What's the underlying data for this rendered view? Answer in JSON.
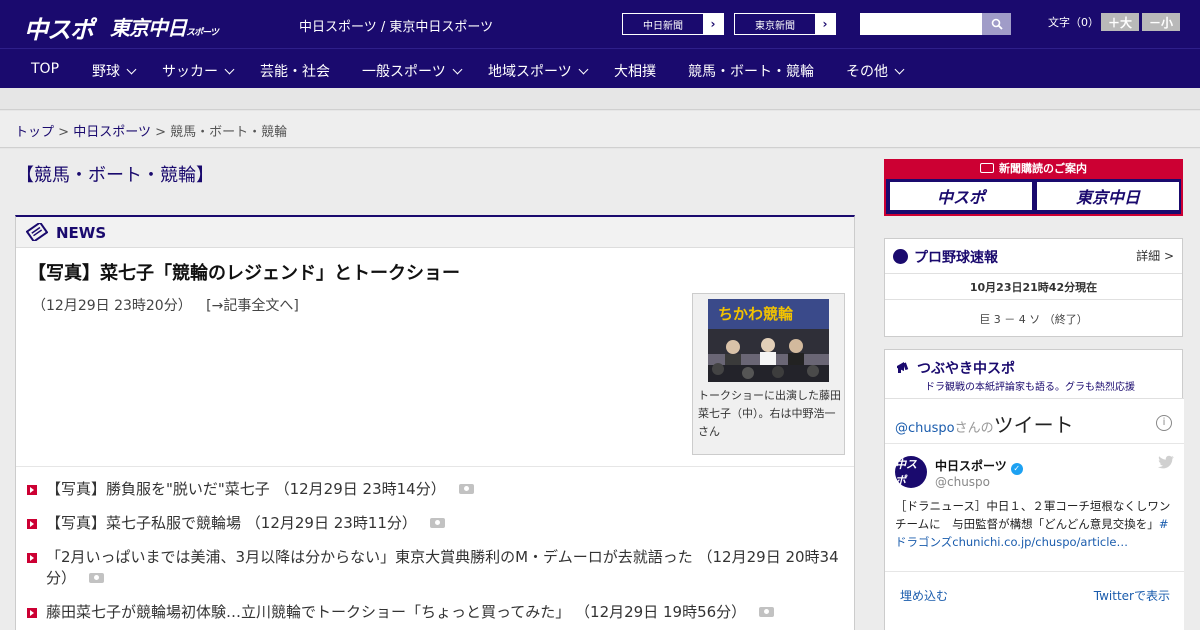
{
  "header": {
    "logo_chuspo": "中スポ",
    "logo_tokyo": "東京中日",
    "logo_tokyo_suffix": "スポーツ",
    "site_title": "中日スポーツ / 東京中日スポーツ",
    "paper_links": [
      {
        "label": "中日新聞"
      },
      {
        "label": "東京新聞"
      }
    ],
    "search": {
      "placeholder": ""
    },
    "font_size_label": "文字（0）",
    "font_larger": "＋大",
    "font_smaller": "－小"
  },
  "nav": {
    "items": [
      {
        "label": "TOP",
        "has_dropdown": false
      },
      {
        "label": "野球",
        "has_dropdown": true
      },
      {
        "label": "サッカー",
        "has_dropdown": true
      },
      {
        "label": "芸能・社会",
        "has_dropdown": false
      },
      {
        "label": "一般スポーツ",
        "has_dropdown": true
      },
      {
        "label": "地域スポーツ",
        "has_dropdown": true
      },
      {
        "label": "大相撲",
        "has_dropdown": false
      },
      {
        "label": "競馬・ボート・競輪",
        "has_dropdown": false
      },
      {
        "label": "その他",
        "has_dropdown": true
      }
    ]
  },
  "breadcrumb": {
    "top": "トップ",
    "section": "中日スポーツ",
    "current": "競馬・ボート・競輪",
    "separator": ">"
  },
  "section_title": "【競馬・ボート・競輪】",
  "news": {
    "label": "NEWS",
    "headline": "【写真】菜七子「競輪のレジェンド」とトークショー",
    "headline_time": "（12月29日 23時20分）",
    "headline_link": "[→記事全文へ]",
    "photo_caption": "トークショーに出演した藤田菜七子（中）。右は中野浩一さん",
    "items": [
      {
        "text": "【写真】勝負服を\"脱いだ\"菜七子",
        "time": "（12月29日 23時14分）",
        "has_photo": true
      },
      {
        "text": "【写真】菜七子私服で競輪場",
        "time": "（12月29日 23時11分）",
        "has_photo": true
      },
      {
        "text": "「2月いっぱいまでは美浦、3月以降は分からない」東京大賞典勝利のM・デムーロが去就語った",
        "time": "（12月29日 20時34分）",
        "has_photo": true
      },
      {
        "text": "藤田菜七子が競輪場初体験…立川競輪でトークショー「ちょっと買ってみた」",
        "time": "（12月29日 19時56分）",
        "has_photo": true
      }
    ]
  },
  "subscription": {
    "title": "新聞購読のご案内",
    "logos": [
      "中スポ",
      "東京中日"
    ]
  },
  "baseball": {
    "title": "プロ野球速報",
    "detail_link": "詳細 >",
    "timestamp": "10月23日21時42分現在",
    "score": "巨 3 － 4 ソ （終了）"
  },
  "tweets": {
    "title": "つぶやき中スポ",
    "subtitle": "ドラ観戦の本紙評論家も語る。グラも熱烈応援",
    "header_handle": "@chuspo",
    "header_san": "さんの",
    "header_big": "ツイート",
    "account_name": "中日スポーツ",
    "account_handle": "@chuspo",
    "avatar_text": "中スポ",
    "tweet_text": "［ドラニュース］中日１、２軍コーチ垣根なくしワンチームに　与田監督が構想「どんどん意見交換を」",
    "tweet_hashtag": "#ドラゴンズ",
    "tweet_link": "chunichi.co.jp/chuspo/article…",
    "embed_link": "埋め込む",
    "view_link": "Twitterで表示"
  },
  "colors": {
    "brand_navy": "#1a0a6e",
    "accent_red": "#cc0033",
    "link_blue": "#1a5cad"
  }
}
